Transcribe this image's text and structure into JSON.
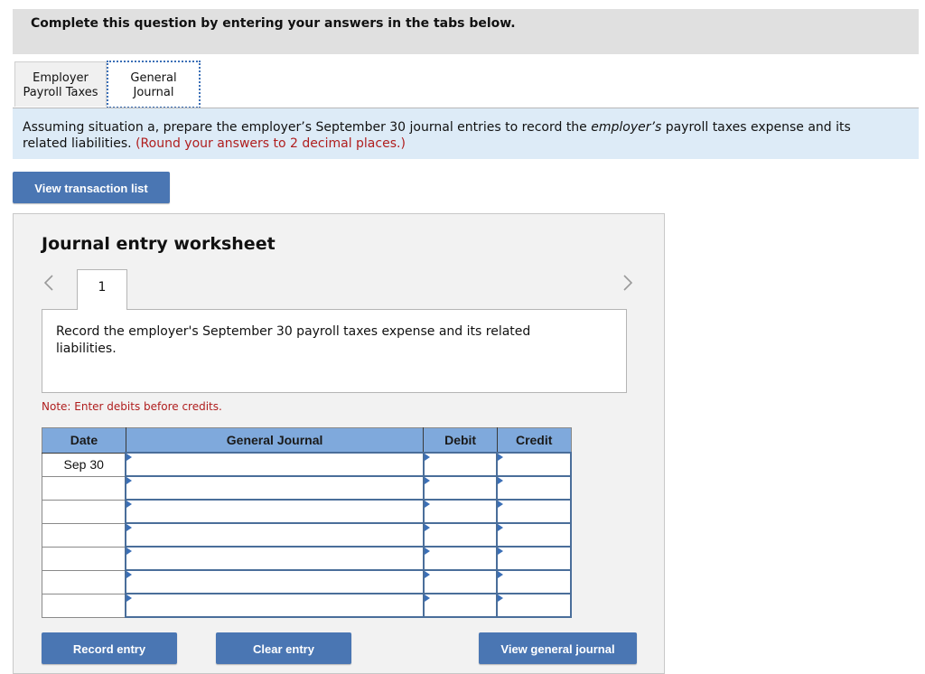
{
  "banner": {
    "text": "Complete this question by entering your answers in the tabs below."
  },
  "tabs": [
    {
      "label_line1": "Employer",
      "label_line2": "Payroll Taxes",
      "active": false
    },
    {
      "label_line1": "General",
      "label_line2": "Journal",
      "active": true
    }
  ],
  "instructions": {
    "part1": "Assuming situation a, prepare the employer’s September 30 journal entries to record the ",
    "italic": "employer’s",
    "part2": " payroll taxes expense and its related liabilities. ",
    "red_note": "(Round your answers to 2 decimal places.)"
  },
  "buttons": {
    "view_transaction_list": "View transaction list",
    "record_entry": "Record entry",
    "clear_entry": "Clear entry",
    "view_general_journal": "View general journal"
  },
  "worksheet": {
    "title": "Journal entry worksheet",
    "prev_icon": "chevron-left",
    "next_icon": "chevron-right",
    "current_step": "1",
    "step_description": "Record the employer's September 30 payroll taxes expense and its related liabilities.",
    "note": "Note: Enter debits before credits."
  },
  "journal": {
    "headers": {
      "date": "Date",
      "general_journal": "General Journal",
      "debit": "Debit",
      "credit": "Credit"
    },
    "rows": [
      {
        "date": "Sep 30",
        "account": "",
        "debit": "",
        "credit": ""
      },
      {
        "date": "",
        "account": "",
        "debit": "",
        "credit": ""
      },
      {
        "date": "",
        "account": "",
        "debit": "",
        "credit": ""
      },
      {
        "date": "",
        "account": "",
        "debit": "",
        "credit": ""
      },
      {
        "date": "",
        "account": "",
        "debit": "",
        "credit": ""
      },
      {
        "date": "",
        "account": "",
        "debit": "",
        "credit": ""
      },
      {
        "date": "",
        "account": "",
        "debit": "",
        "credit": ""
      }
    ]
  },
  "colors": {
    "accent_button": "#4a76b3",
    "header_blue": "#7fa9dc",
    "instruction_bg": "#ddebf7",
    "note_red": "#b01e1e"
  }
}
